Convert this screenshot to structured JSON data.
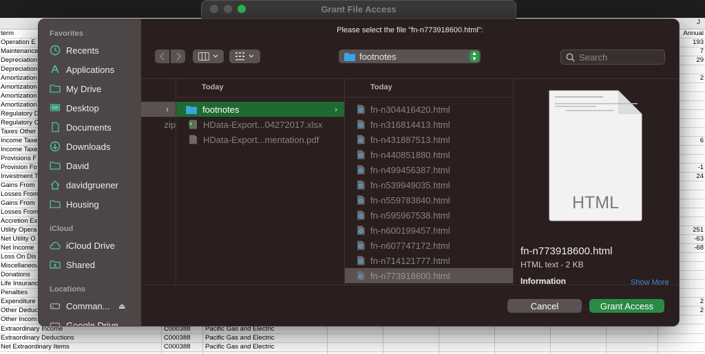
{
  "background": {
    "window_title": "Grant File Access",
    "column_letter": "J",
    "column_letter_left": "Annual",
    "right_values": [
      "193",
      "7",
      "29",
      "",
      "2",
      "",
      "",
      "",
      "",
      "",
      "",
      "6",
      "",
      "",
      "-1",
      "24",
      "",
      "",
      "",
      "",
      "",
      "251",
      "-63",
      "-68",
      "",
      "",
      "",
      "",
      "",
      "2",
      "2"
    ],
    "rows": [
      "term",
      "Operation E",
      "Maintenance",
      "Depreciation",
      "Depreciation",
      "Amortization",
      "Amortization",
      "Amortization",
      "Amortization",
      "Regulatory D",
      "Regulatory C",
      "Taxes Other",
      "Income Taxe",
      "Income Taxe",
      "Provisions F",
      "Provision Fo",
      "Investment T",
      "Gains From",
      "Losses From",
      "Gains From",
      "Losses From",
      "Accretion Ex",
      "Utility Opera",
      "Net Utility O",
      "Net Income",
      "Loss On Dis",
      "Miscellaneou",
      "Donations",
      "Life Insuranc",
      "Penalties",
      "Expenditure",
      "Other Deduc",
      "Other Incom"
    ],
    "bottom_rows": [
      {
        "name": "Extraordinary Income",
        "code": "C000388",
        "company": "Pacific Gas and Electric"
      },
      {
        "name": "Extraordinary Deductions",
        "code": "C000388",
        "company": "Pacific Gas and Electric"
      },
      {
        "name": "Net Extraordinary Items",
        "code": "C000388",
        "company": "Pacific Gas and Electric"
      }
    ]
  },
  "dialog": {
    "prompt": "Please select the file \"fn-n773918600.html\":",
    "sidebar": {
      "favorites_label": "Favorites",
      "favorites": [
        {
          "label": "Recents",
          "icon": "clock-icon"
        },
        {
          "label": "Applications",
          "icon": "applications-icon"
        },
        {
          "label": "My Drive",
          "icon": "folder-icon"
        },
        {
          "label": "Desktop",
          "icon": "desktop-icon"
        },
        {
          "label": "Documents",
          "icon": "document-icon"
        },
        {
          "label": "Downloads",
          "icon": "download-icon"
        },
        {
          "label": "David",
          "icon": "folder-icon"
        },
        {
          "label": "davidgruener",
          "icon": "home-icon"
        },
        {
          "label": "Housing",
          "icon": "folder-icon"
        }
      ],
      "icloud_label": "iCloud",
      "icloud": [
        {
          "label": "iCloud Drive",
          "icon": "cloud-icon"
        },
        {
          "label": "Shared",
          "icon": "shared-folder-icon"
        }
      ],
      "locations_label": "Locations",
      "locations": [
        {
          "label": "Comman...",
          "icon": "drive-icon",
          "eject": "⏏"
        },
        {
          "label": "Google Drive",
          "icon": "drive-icon"
        }
      ]
    },
    "location": "footnotes",
    "search_placeholder": "Search",
    "columns": [
      {
        "header": "",
        "items": [
          {
            "name": "",
            "selected": "dim"
          },
          {
            "name": "zip"
          }
        ]
      },
      {
        "header": "Today",
        "items": [
          {
            "name": "footnotes",
            "kind": "folder",
            "selected": "active"
          },
          {
            "name": "HData-Export...04272017.xlsx",
            "kind": "xlsx"
          },
          {
            "name": "HData-Export...mentation.pdf",
            "kind": "pdf"
          }
        ]
      },
      {
        "header": "Today",
        "items": [
          {
            "name": "fn-n304416420.html"
          },
          {
            "name": "fn-n316814413.html"
          },
          {
            "name": "fn-n431887513.html"
          },
          {
            "name": "fn-n440851880.html"
          },
          {
            "name": "fn-n499456387.html"
          },
          {
            "name": "fn-n539949035.html"
          },
          {
            "name": "fn-n559783840.html"
          },
          {
            "name": "fn-n595967538.html"
          },
          {
            "name": "fn-n600199457.html"
          },
          {
            "name": "fn-n607747172.html"
          },
          {
            "name": "fn-n714121777.html"
          },
          {
            "name": "fn-n773918600.html",
            "selected": "gray"
          }
        ]
      }
    ],
    "preview": {
      "icon_label": "HTML",
      "file_name": "fn-n773918600.html",
      "kind": "HTML text - 2 KB",
      "info_label": "Information",
      "show_more": "Show More"
    },
    "buttons": {
      "cancel": "Cancel",
      "grant": "Grant Access"
    },
    "colors": {
      "accent": "#1f6a31",
      "grant": "#2a8a45",
      "folder": "#3ba4e6"
    }
  }
}
